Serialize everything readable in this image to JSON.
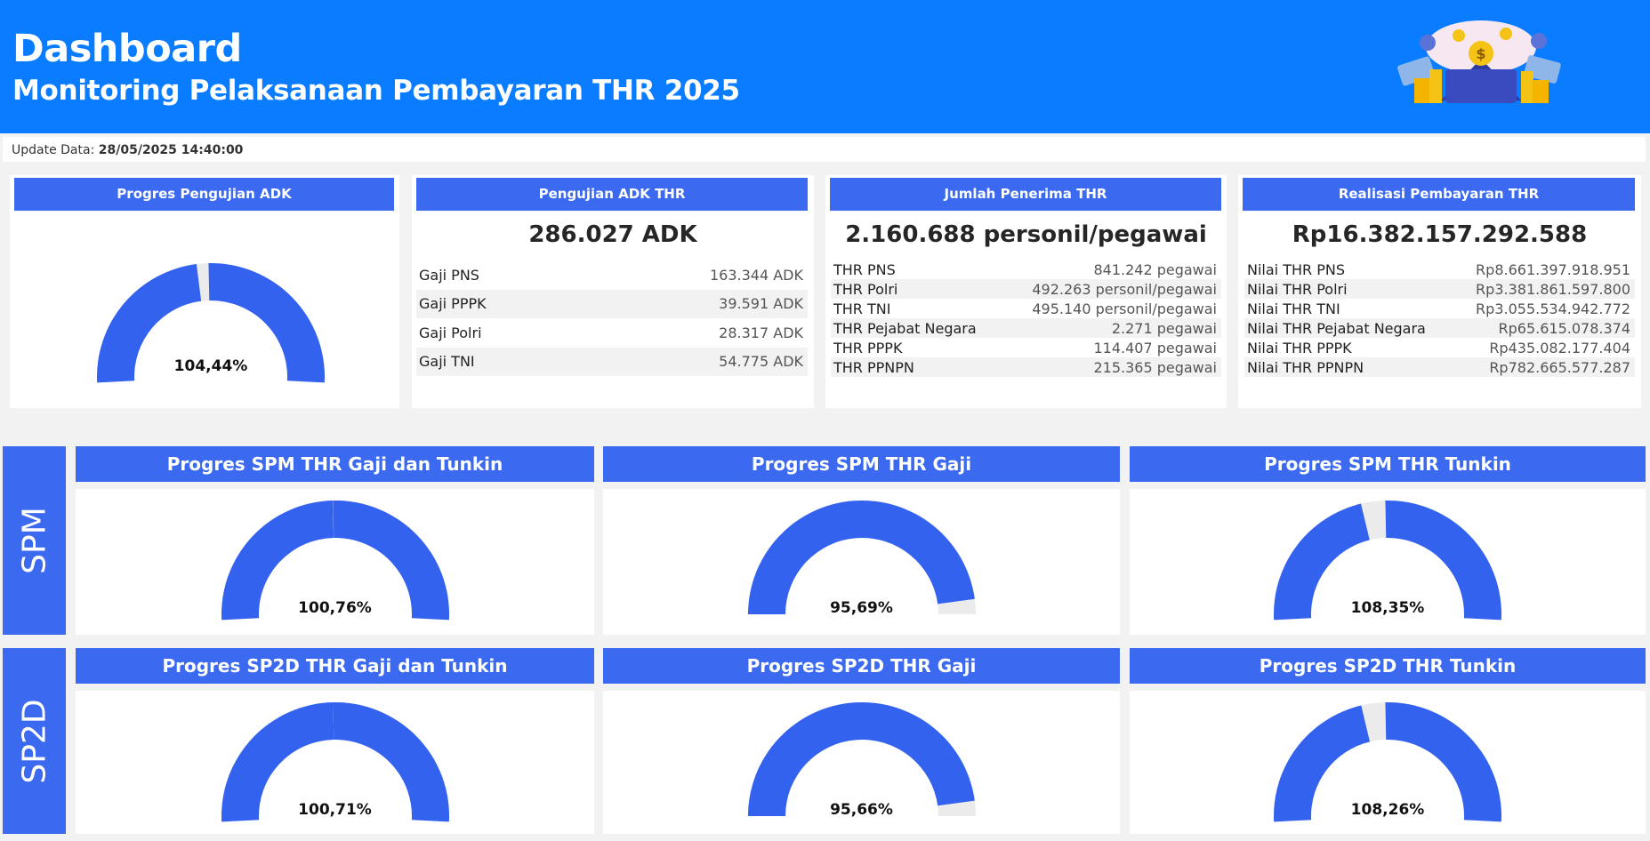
{
  "header": {
    "title": "Dashboard",
    "subtitle": "Monitoring Pelaksanaan Pembayaran THR 2025"
  },
  "update": {
    "label": "Update Data:",
    "value": "28/05/2025 14:40:00"
  },
  "colors": {
    "header_bg": "#0a7cff",
    "accent": "#3b6af0",
    "gauge_fill": "#3362ee",
    "gauge_track": "#ebebeb"
  },
  "cards": {
    "adk_progress": {
      "title": "Progres Pengujian ADK",
      "value": "104,44%",
      "percent": 104.44
    },
    "adk_test": {
      "title": "Pengujian ADK THR",
      "total": "286.027 ADK",
      "rows": [
        {
          "label": "Gaji PNS",
          "value": "163.344 ADK"
        },
        {
          "label": "Gaji PPPK",
          "value": "39.591 ADK"
        },
        {
          "label": "Gaji Polri",
          "value": "28.317 ADK"
        },
        {
          "label": "Gaji TNI",
          "value": "54.775 ADK"
        }
      ]
    },
    "recipients": {
      "title": "Jumlah Penerima THR",
      "total": "2.160.688 personil/pegawai",
      "rows": [
        {
          "label": "THR PNS",
          "value": "841.242 pegawai"
        },
        {
          "label": "THR Polri",
          "value": "492.263 personil/pegawai"
        },
        {
          "label": "THR TNI",
          "value": "495.140 personil/pegawai"
        },
        {
          "label": "THR Pejabat Negara",
          "value": "2.271 pegawai"
        },
        {
          "label": "THR PPPK",
          "value": "114.407 pegawai"
        },
        {
          "label": "THR PPNPN",
          "value": "215.365 pegawai"
        }
      ]
    },
    "realization": {
      "title": "Realisasi Pembayaran THR",
      "total": "Rp16.382.157.292.588",
      "rows": [
        {
          "label": "Nilai THR PNS",
          "value": "Rp8.661.397.918.951"
        },
        {
          "label": "Nilai THR Polri",
          "value": "Rp3.381.861.597.800"
        },
        {
          "label": "Nilai THR TNI",
          "value": "Rp3.055.534.942.772"
        },
        {
          "label": "Nilai THR Pejabat Negara",
          "value": "Rp65.615.078.374"
        },
        {
          "label": "Nilai THR PPPK",
          "value": "Rp435.082.177.404"
        },
        {
          "label": "Nilai THR PPNPN",
          "value": "Rp782.665.577.287"
        }
      ]
    }
  },
  "spm": {
    "side_label": "SPM",
    "panels": [
      {
        "title": "Progres SPM THR Gaji dan Tunkin",
        "value": "100,76%",
        "percent": 100.76
      },
      {
        "title": "Progres SPM THR Gaji",
        "value": "95,69%",
        "percent": 95.69
      },
      {
        "title": "Progres SPM THR Tunkin",
        "value": "108,35%",
        "percent": 108.35
      }
    ]
  },
  "sp2d": {
    "side_label": "SP2D",
    "panels": [
      {
        "title": "Progres SP2D THR Gaji dan Tunkin",
        "value": "100,71%",
        "percent": 100.71
      },
      {
        "title": "Progres SP2D THR Gaji",
        "value": "95,66%",
        "percent": 95.66
      },
      {
        "title": "Progres SP2D THR Tunkin",
        "value": "108,26%",
        "percent": 108.26
      }
    ]
  }
}
